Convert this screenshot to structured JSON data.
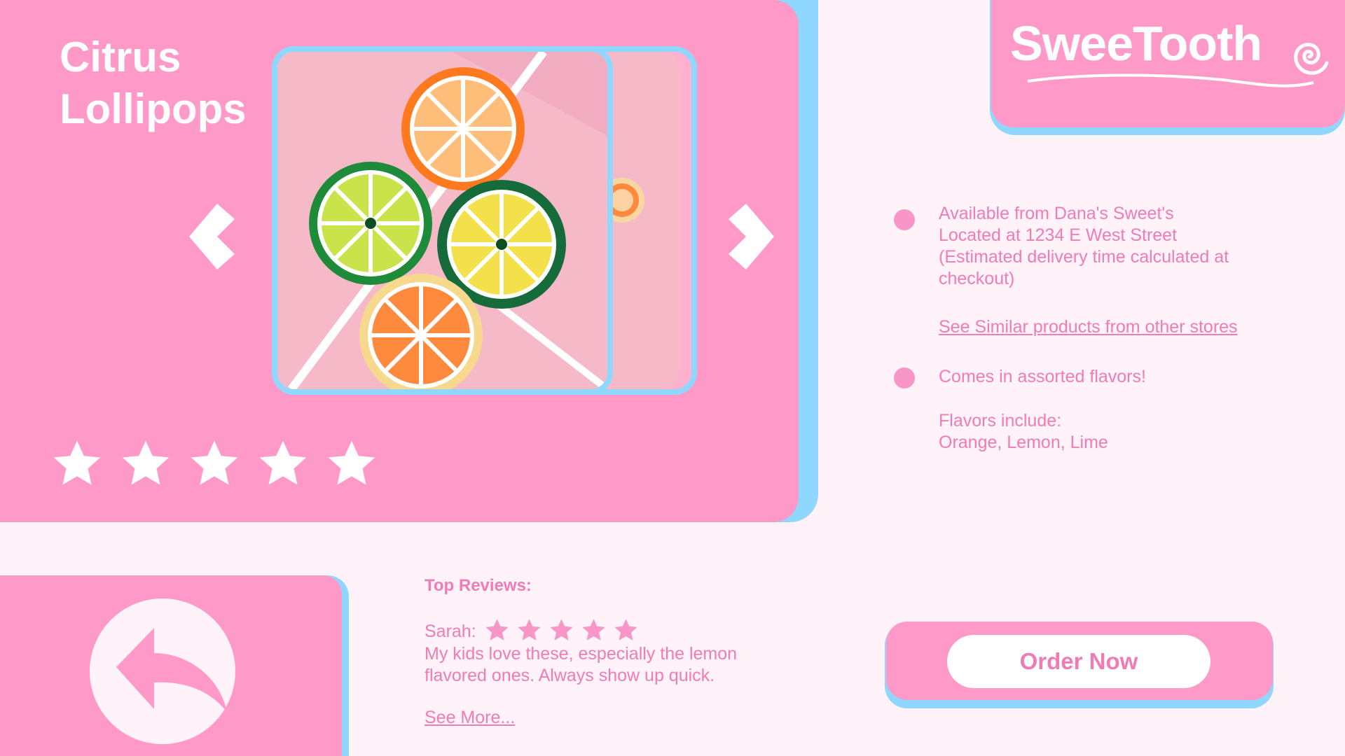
{
  "brand": {
    "name": "SweeTooth"
  },
  "product": {
    "title": "Citrus Lollipops",
    "rating": 5,
    "rating_max": 5
  },
  "info": {
    "availability": "Available from Dana's Sweet's Located at 1234 E West Street (Estimated delivery time calculated at checkout)",
    "similar_link": "See Similar products from other stores",
    "flavors_note": "Comes in assorted flavors!",
    "flavors_heading": "Flavors include:",
    "flavors_list": "Orange, Lemon, Lime"
  },
  "reviews": {
    "heading": "Top Reviews:",
    "items": [
      {
        "author": "Sarah:",
        "rating": 5,
        "text": "My kids love these, especially the lemon flavored ones. Always show up quick."
      }
    ],
    "see_more": "See More..."
  },
  "actions": {
    "order": "Order Now"
  },
  "icons": {
    "prev": "chevron-left-icon",
    "next": "chevron-right-icon",
    "star": "star-icon",
    "back": "back-arrow-icon",
    "bullet": "bullet-icon",
    "swirl": "swirl-icon"
  },
  "colors": {
    "pink": "#ff99c8",
    "blue": "#8fd7ff",
    "text_pink": "#f07cb5",
    "background": "#fff2f8"
  }
}
